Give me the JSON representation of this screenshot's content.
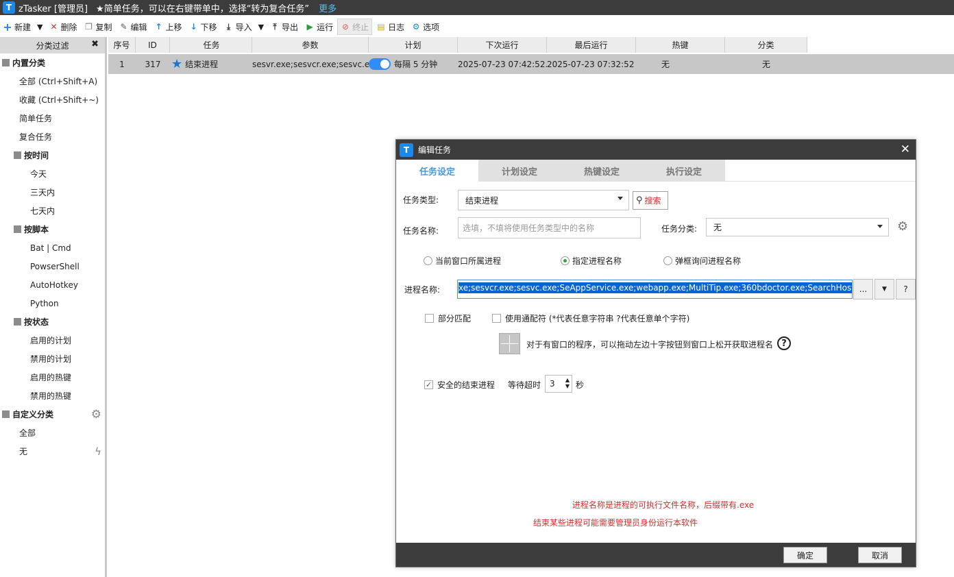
{
  "app": {
    "title": "zTasker [管理员]",
    "tip": "★简单任务，可以在右键带单中，选择“转为复合任务”",
    "more": "更多",
    "logo_letter": "T"
  },
  "toolbar": {
    "new": "新建",
    "delete": "删除",
    "copy": "复制",
    "edit": "编辑",
    "up": "上移",
    "down": "下移",
    "import": "导入",
    "export": "导出",
    "run": "运行",
    "stop": "终止",
    "log": "日志",
    "options": "选项"
  },
  "sidebar": {
    "title": "分类过滤",
    "builtin": "内置分类",
    "all": "全部 (Ctrl+Shift+A)",
    "fav": "收藏 (Ctrl+Shift+~)",
    "simple": "简单任务",
    "compound": "复合任务",
    "by_time": "按时间",
    "today": "今天",
    "three_days": "三天内",
    "seven_days": "七天内",
    "by_script": "按脚本",
    "bat": "Bat | Cmd",
    "ps": "PowserShell",
    "ahk": "AutoHotkey",
    "python": "Python",
    "by_state": "按状态",
    "plan_on": "启用的计划",
    "plan_off": "禁用的计划",
    "hot_on": "启用的热键",
    "hot_off": "禁用的热键",
    "custom": "自定义分类",
    "custom_all": "全部",
    "none": "无"
  },
  "grid": {
    "headers": {
      "seq": "序号",
      "id": "ID",
      "task": "任务",
      "param": "参数",
      "plan": "计划",
      "next": "下次运行",
      "last": "最后运行",
      "hotkey": "热键",
      "category": "分类"
    },
    "rows": [
      {
        "seq": "1",
        "id": "317",
        "task": "结束进程",
        "param": "sesvr.exe;sesvcr.exe;sesvc.e...",
        "plan": "每隔 5 分钟",
        "next": "2025-07-23 07:42:52...",
        "last": "2025-07-23 07:32:52",
        "hotkey": "无",
        "category": "无"
      }
    ]
  },
  "dialog": {
    "title": "编辑任务",
    "tabs": [
      "任务设定",
      "计划设定",
      "热键设定",
      "执行设定"
    ],
    "task_type_label": "任务类型:",
    "task_type_value": "结束进程",
    "search": "搜索",
    "task_name_label": "任务名称:",
    "task_name_placeholder": "选填，不填将使用任务类型中的名称",
    "task_cat_label": "任务分类:",
    "task_cat_value": "无",
    "radio_current": "当前窗口所属进程",
    "radio_named": "指定进程名称",
    "radio_prompt": "弹框询问进程名称",
    "proc_label": "进程名称:",
    "proc_value": "xe;sesvcr.exe;sesvc.exe;SeAppService.exe;webapp.exe;MultiTip.exe;360bdoctor.exe;SearchHost.exe",
    "btn_more": "...",
    "btn_help": "?",
    "partial_match": "部分匹配",
    "wildcard": "使用通配符 (*代表任意字符串 ?代表任意单个字符)",
    "drag_tip": "对于有窗口的程序，可以拖动左边十字按钮到窗口上松开获取进程名",
    "safe_kill": "安全的结束进程",
    "wait_label": "等待超时",
    "wait_value": "3",
    "wait_unit": "秒",
    "note1": "进程名称是进程的可执行文件名称，后缀带有.exe",
    "note2": "结束某些进程可能需要管理员身份运行本软件",
    "ok": "确定",
    "cancel": "取消"
  }
}
